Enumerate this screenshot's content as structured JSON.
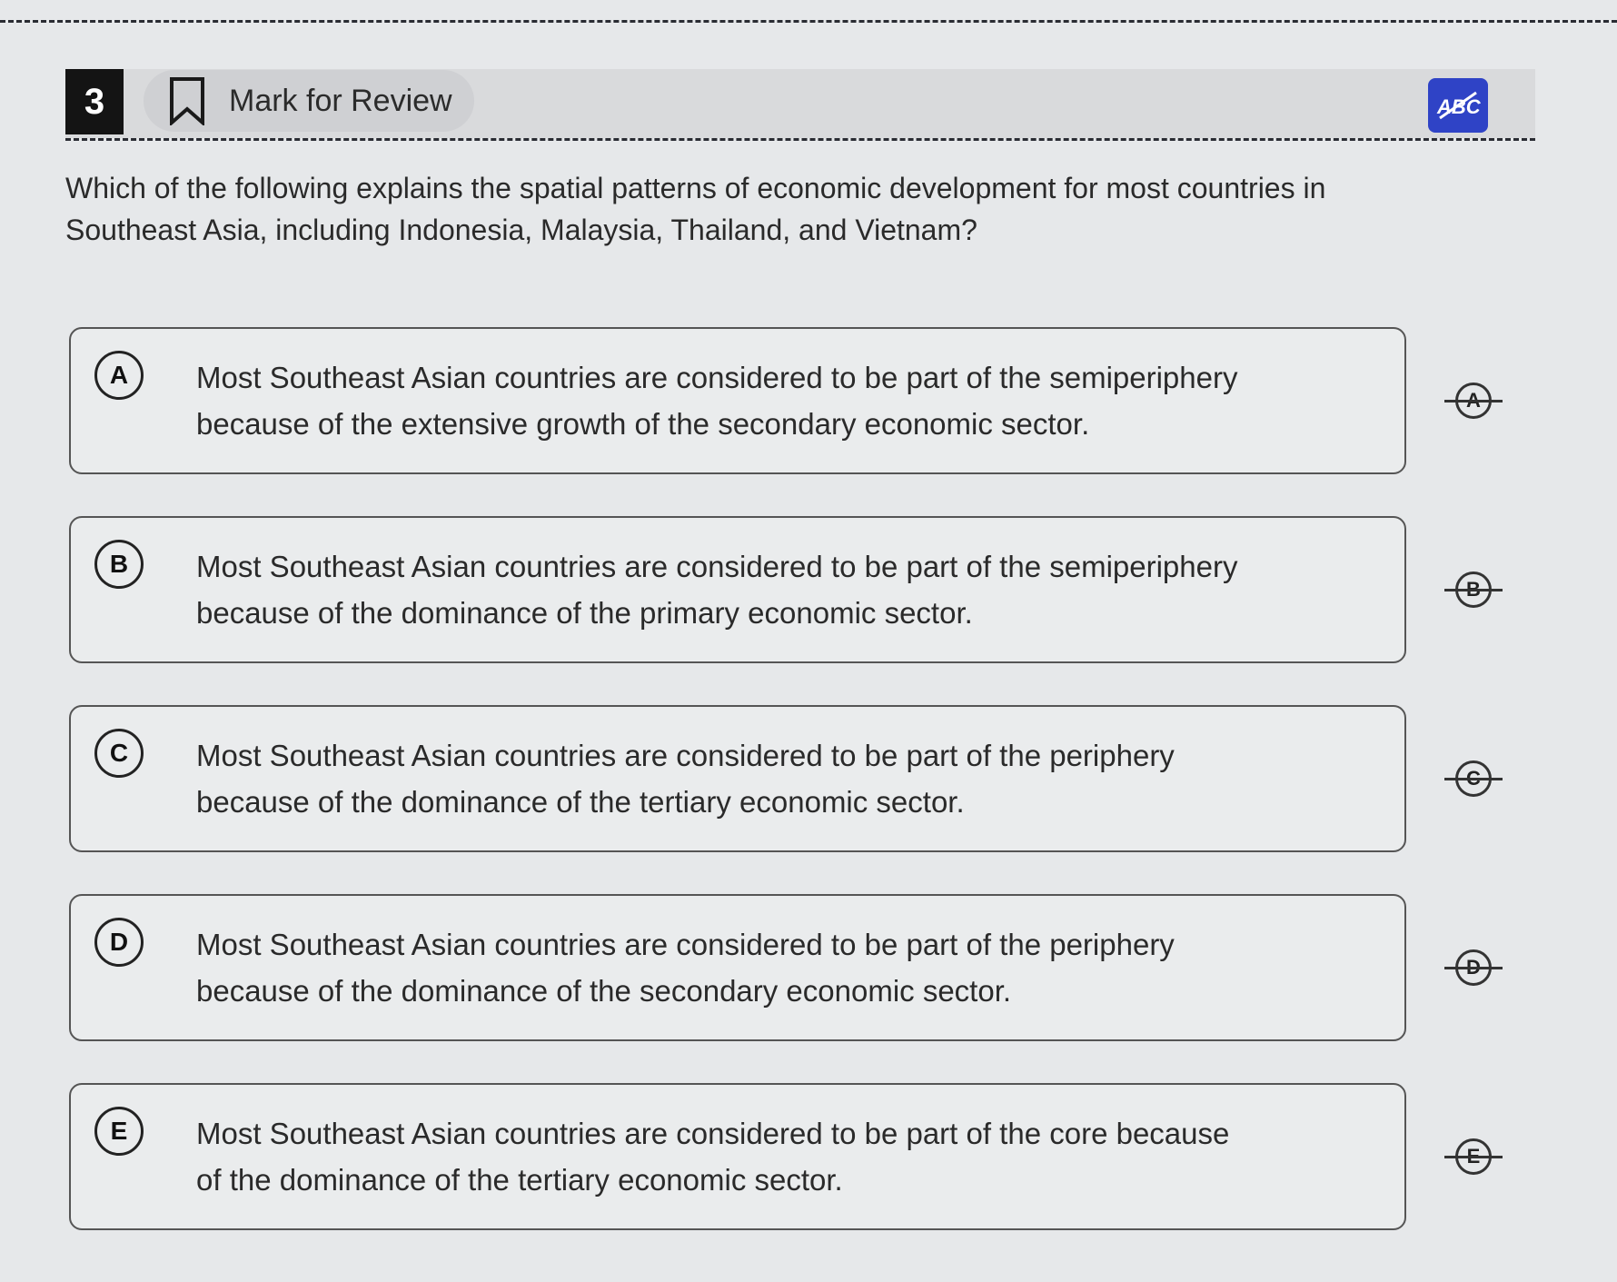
{
  "header": {
    "question_number": "3",
    "mark_for_review_label": "Mark for Review",
    "abc_tool_icon": "abc-strikethrough-icon",
    "accent_color": "#2f43c6"
  },
  "question": {
    "text": "Which of the following explains the spatial patterns of economic development for most countries in Southeast Asia, including Indonesia, Malaysia, Thailand, and Vietnam?"
  },
  "options": [
    {
      "letter": "A",
      "line1": "Most Southeast Asian countries are considered to be part of the semiperiphery",
      "line2": "because of the extensive growth of the secondary economic sector."
    },
    {
      "letter": "B",
      "line1": "Most Southeast Asian countries are considered to be part of the semiperiphery",
      "line2": "because of the dominance of the primary economic sector."
    },
    {
      "letter": "C",
      "line1": "Most Southeast Asian countries are considered to be part of the periphery",
      "line2": "because of the dominance of the tertiary economic sector."
    },
    {
      "letter": "D",
      "line1": "Most Southeast Asian countries are considered to be part of the periphery",
      "line2": "because of the dominance of the secondary economic sector."
    },
    {
      "letter": "E",
      "line1": "Most Southeast Asian countries are considered to be part of the core because",
      "line2": "of the dominance of the tertiary economic sector."
    }
  ]
}
